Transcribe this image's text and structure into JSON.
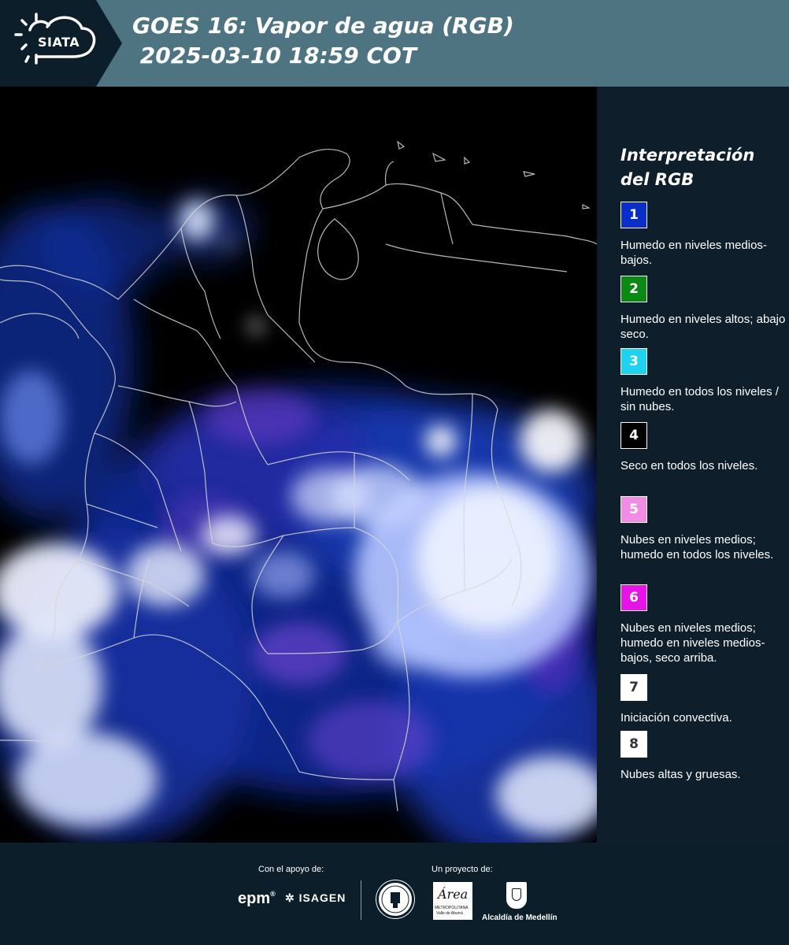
{
  "header": {
    "logo_text": "SIATA",
    "title_line1": "GOES 16: Vapor de agua (RGB)",
    "title_line2": " 2025-03-10 18:59 COT"
  },
  "legend": {
    "title": "Interpretación del RGB",
    "items": [
      {
        "number": "1",
        "color": "#0a2fc8",
        "text_color": "#ffffff",
        "description": "Humedo en niveles medios-bajos."
      },
      {
        "number": "2",
        "color": "#0a8a14",
        "text_color": "#ffffff",
        "description": "Humedo en niveles altos; abajo seco."
      },
      {
        "number": "3",
        "color": "#1ed2f0",
        "text_color": "#ffffff",
        "description": "Humedo en todos los niveles / sin nubes."
      },
      {
        "number": "4",
        "color": "#000000",
        "text_color": "#ffffff",
        "description": "Seco en todos los niveles."
      },
      {
        "number": "5",
        "color": "#f08ce6",
        "text_color": "#ffffff",
        "description": "Nubes en niveles medios; humedo en todos los niveles."
      },
      {
        "number": "6",
        "color": "#e614e6",
        "text_color": "#ffffff",
        "description": "Nubes en niveles medios; humedo en niveles medios-bajos, seco arriba."
      },
      {
        "number": "7",
        "color": "#ffffff",
        "text_color": "#333333",
        "description": "Iniciación convectiva."
      },
      {
        "number": "8",
        "color": "#ffffff",
        "text_color": "#333333",
        "description": "Nubes altas y gruesas."
      }
    ]
  },
  "footer": {
    "support_label": "Con el apoyo de:",
    "project_label": "Un proyecto de:",
    "epm": "epm",
    "isagen": "ISAGEN",
    "area_script": "Área",
    "area_caption": "METROPOLITANA",
    "area_caption2": "Valle de Aburrá",
    "medellin": "Alcaldía de Medellín"
  }
}
